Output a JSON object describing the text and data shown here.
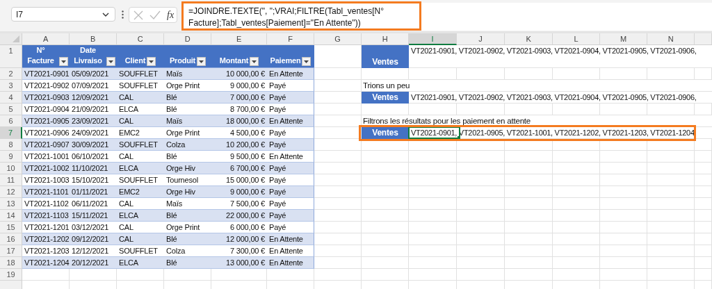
{
  "formula_bar": {
    "name_box": "I7",
    "function_label": "fx",
    "formula": "=JOINDRE.TEXTE(\", \";VRAI;FILTRE(Tabl_ventes[N° Facture];Tabl_ventes[Paiement]=\"En Attente\"))",
    "highlighted": true
  },
  "column_headers": [
    {
      "label": "A",
      "selected": false
    },
    {
      "label": "B",
      "selected": false
    },
    {
      "label": "C",
      "selected": false
    },
    {
      "label": "D",
      "selected": false
    },
    {
      "label": "E",
      "selected": false
    },
    {
      "label": "F",
      "selected": false
    },
    {
      "label": "G",
      "selected": false
    },
    {
      "label": "H",
      "selected": false
    },
    {
      "label": "I",
      "selected": true
    },
    {
      "label": "J",
      "selected": false
    },
    {
      "label": "K",
      "selected": false
    },
    {
      "label": "L",
      "selected": false
    },
    {
      "label": "M",
      "selected": false
    },
    {
      "label": "N",
      "selected": false
    }
  ],
  "row_headers": [
    {
      "label": "1",
      "selected": false
    },
    {
      "label": "2",
      "selected": false
    },
    {
      "label": "3",
      "selected": false
    },
    {
      "label": "4",
      "selected": false
    },
    {
      "label": "5",
      "selected": false
    },
    {
      "label": "6",
      "selected": false
    },
    {
      "label": "7",
      "selected": true
    },
    {
      "label": "8",
      "selected": false
    },
    {
      "label": "9",
      "selected": false
    },
    {
      "label": "10",
      "selected": false
    },
    {
      "label": "11",
      "selected": false
    },
    {
      "label": "12",
      "selected": false
    },
    {
      "label": "13",
      "selected": false
    },
    {
      "label": "14",
      "selected": false
    },
    {
      "label": "15",
      "selected": false
    },
    {
      "label": "16",
      "selected": false
    },
    {
      "label": "17",
      "selected": false
    },
    {
      "label": "18",
      "selected": false
    },
    {
      "label": "19",
      "selected": false
    }
  ],
  "table": {
    "columns": [
      {
        "label": "N° Facture",
        "kind": "text"
      },
      {
        "label": "Date Livraiso",
        "kind": "text"
      },
      {
        "label": "Client",
        "kind": "text"
      },
      {
        "label": "Produit",
        "kind": "text"
      },
      {
        "label": "Montant",
        "kind": "amount"
      },
      {
        "label": "Paiemen",
        "kind": "text"
      }
    ],
    "rows": [
      [
        "VT2021-0901",
        "05/09/2021",
        "SOUFFLET",
        "Maïs",
        "10 000,00 €",
        "En Attente"
      ],
      [
        "VT2021-0902",
        "07/09/2021",
        "SOUFFLET",
        "Orge Print",
        "9 000,00 €",
        "Payé"
      ],
      [
        "VT2021-0903",
        "12/09/2021",
        "CAL",
        "Blé",
        "7 000,00 €",
        "Payé"
      ],
      [
        "VT2021-0904",
        "21/09/2021",
        "ELCA",
        "Blé",
        "8 700,00 €",
        "Payé"
      ],
      [
        "VT2021-0905",
        "23/09/2021",
        "CAL",
        "Maïs",
        "18 000,00 €",
        "En Attente"
      ],
      [
        "VT2021-0906",
        "24/09/2021",
        "EMC2",
        "Orge Print",
        "4 500,00 €",
        "Payé"
      ],
      [
        "VT2021-0907",
        "30/09/2021",
        "SOUFFLET",
        "Colza",
        "10 200,00 €",
        "Payé"
      ],
      [
        "VT2021-1001",
        "06/10/2021",
        "CAL",
        "Blé",
        "9 500,00 €",
        "En Attente"
      ],
      [
        "VT2021-1002",
        "11/10/2021",
        "ELCA",
        "Orge Hiv",
        "6 700,00 €",
        "Payé"
      ],
      [
        "VT2021-1003",
        "15/10/2021",
        "SOUFFLET",
        "Tournesol",
        "15 000,00 €",
        "Payé"
      ],
      [
        "VT2021-1101",
        "01/11/2021",
        "EMC2",
        "Orge Hiv",
        "9 000,00 €",
        "Payé"
      ],
      [
        "VT2021-1102",
        "06/11/2021",
        "CAL",
        "Maïs",
        "7 500,00 €",
        "Payé"
      ],
      [
        "VT2021-1103",
        "15/11/2021",
        "ELCA",
        "Blé",
        "22 000,00 €",
        "Payé"
      ],
      [
        "VT2021-1201",
        "03/12/2021",
        "CAL",
        "Orge Print",
        "6 000,00 €",
        "Payé"
      ],
      [
        "VT2021-1202",
        "09/12/2021",
        "CAL",
        "Blé",
        "12 000,00 €",
        "En Attente"
      ],
      [
        "VT2021-1203",
        "12/12/2021",
        "SOUFFLET",
        "Colza",
        "7 300,00 €",
        "En Attente"
      ],
      [
        "VT2021-1204",
        "20/12/2021",
        "ELCA",
        "Blé",
        "13 000,00 €",
        "En Attente"
      ]
    ]
  },
  "side_rows": [
    {
      "kind": "result",
      "label": "Ventes",
      "value": "VT2021-0901, VT2021-0902, VT2021-0903, VT2021-0904, VT2021-0905, VT2021-0906,",
      "highlighted": false,
      "active_cell": false
    },
    {
      "kind": "blank"
    },
    {
      "kind": "note",
      "text": "Trions un peu"
    },
    {
      "kind": "result",
      "label": "Ventes",
      "value": "VT2021-0901, VT2021-0902, VT2021-0903, VT2021-0904, VT2021-0905, VT2021-0906,",
      "highlighted": false,
      "active_cell": false
    },
    {
      "kind": "blank"
    },
    {
      "kind": "note",
      "text": "Filtrons les résultats pour les paiement en attente"
    },
    {
      "kind": "result",
      "label": "Ventes",
      "value": "VT2021-0901, VT2021-0905, VT2021-1001, VT2021-1202, VT2021-1203, VT2021-1204",
      "highlighted": true,
      "active_cell": true
    }
  ]
}
